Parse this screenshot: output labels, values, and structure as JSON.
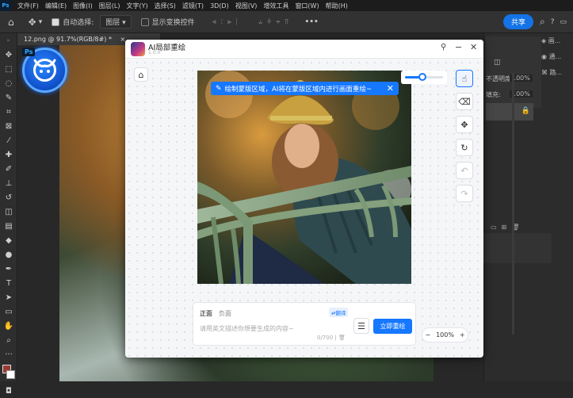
{
  "menubar": {
    "app_badge": "Ps",
    "items": [
      "文件(F)",
      "编辑(E)",
      "图像(I)",
      "图层(L)",
      "文字(Y)",
      "选择(S)",
      "滤镜(T)",
      "3D(D)",
      "视图(V)",
      "增效工具",
      "窗口(W)",
      "帮助(H)"
    ]
  },
  "options": {
    "auto_select_label": "自动选择:",
    "layer_select_value": "图层",
    "show_transform_label": "显示变换控件",
    "more_label": "•••",
    "share_label": "共享"
  },
  "document": {
    "tab_title": "12.png @ 91.7%(RGB/8#) *"
  },
  "right_panel": {
    "opacity_label": "不透明度:",
    "opacity_value": "100%",
    "fill_label": "填充:",
    "fill_value": "100%",
    "panel_a": "画...",
    "panel_b": "通...",
    "panel_c": "路..."
  },
  "dialog": {
    "title": "AI局部重绘",
    "version": "1.0.0",
    "tip_text": "绘制蒙版区域，AI将在蒙版区域内进行画面重绘~",
    "brush_size": 0.45,
    "prompt": {
      "tab_positive": "正面",
      "tab_negative": "负面",
      "translate_badge": "翻译",
      "placeholder": "请用英文描述你想要生成的内容~",
      "counter": "0/700"
    },
    "generate_label": "立即重绘",
    "zoom_value": "100%"
  },
  "colors": {
    "accent": "#1677ff",
    "ps_blue": "#31a8ff"
  }
}
